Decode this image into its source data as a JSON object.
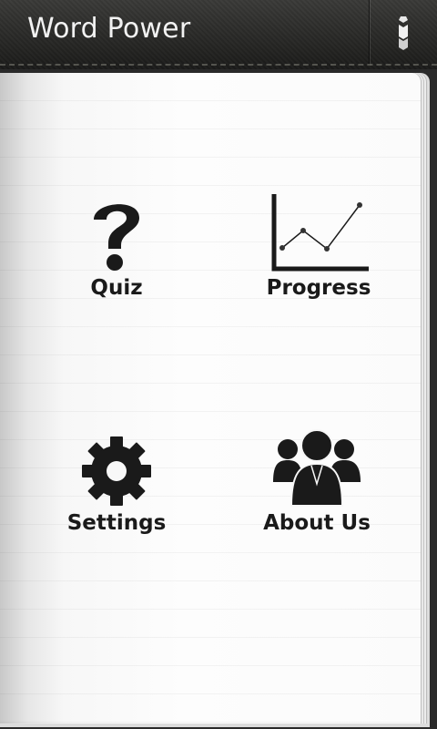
{
  "app": {
    "title": "Word Power"
  },
  "header": {
    "menu_icon": "overflow-menu-icon"
  },
  "menu": {
    "items": [
      {
        "label": "Quiz",
        "icon": "question-mark-icon"
      },
      {
        "label": "Progress",
        "icon": "line-chart-icon"
      },
      {
        "label": "Settings",
        "icon": "gear-icon"
      },
      {
        "label": "About Us",
        "icon": "people-group-icon"
      }
    ]
  },
  "colors": {
    "icon": "#1a1a1a",
    "header_text": "#f2f2f2"
  }
}
